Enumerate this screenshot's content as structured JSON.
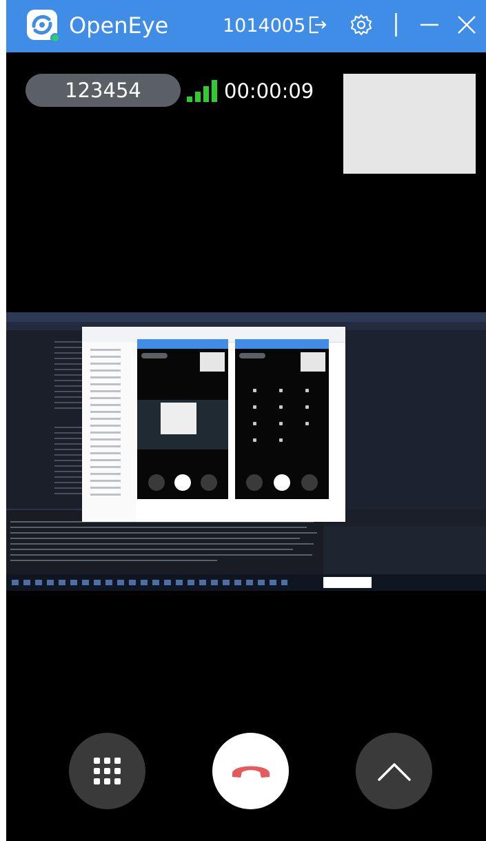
{
  "app": {
    "title": "OpenEye",
    "user_id": "1014005",
    "logo_icon": "openeye-logo",
    "status_dot_color": "#2ecc71"
  },
  "titlebar": {
    "background": "#3f8de6",
    "icons": [
      "exit-icon",
      "gear-icon",
      "minimize-icon",
      "close-icon"
    ]
  },
  "call": {
    "peer_id": "123454",
    "duration": "00:00:09",
    "signal_icon": "signal-strength-icon",
    "signal_color": "#2ecc2e"
  },
  "controls": {
    "dialpad_icon": "dialpad-icon",
    "hangup_icon": "hangup-phone-icon",
    "hangup_color": "#e55a5a",
    "expand_icon": "chevron-up-icon"
  }
}
